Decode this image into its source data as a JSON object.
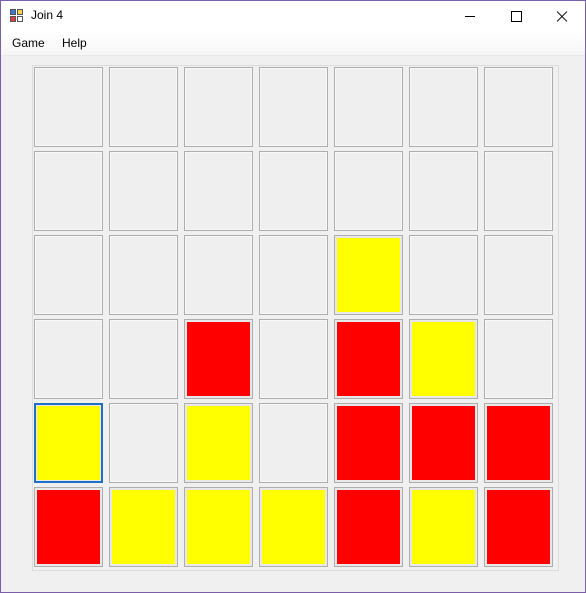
{
  "window": {
    "title": "Join 4"
  },
  "menu": {
    "items": [
      "Game",
      "Help"
    ]
  },
  "colors": {
    "red": "#ff0000",
    "yellow": "#ffff00",
    "empty": "#efefef"
  },
  "board": {
    "rows": 6,
    "cols": 7,
    "focused": [
      4,
      0
    ],
    "cells": [
      [
        "empty",
        "empty",
        "empty",
        "empty",
        "empty",
        "empty",
        "empty"
      ],
      [
        "empty",
        "empty",
        "empty",
        "empty",
        "empty",
        "empty",
        "empty"
      ],
      [
        "empty",
        "empty",
        "empty",
        "empty",
        "yellow",
        "empty",
        "empty"
      ],
      [
        "empty",
        "empty",
        "red",
        "empty",
        "red",
        "yellow",
        "empty"
      ],
      [
        "yellow",
        "empty",
        "yellow",
        "empty",
        "red",
        "red",
        "red"
      ],
      [
        "red",
        "yellow",
        "yellow",
        "yellow",
        "red",
        "yellow",
        "red"
      ]
    ]
  }
}
